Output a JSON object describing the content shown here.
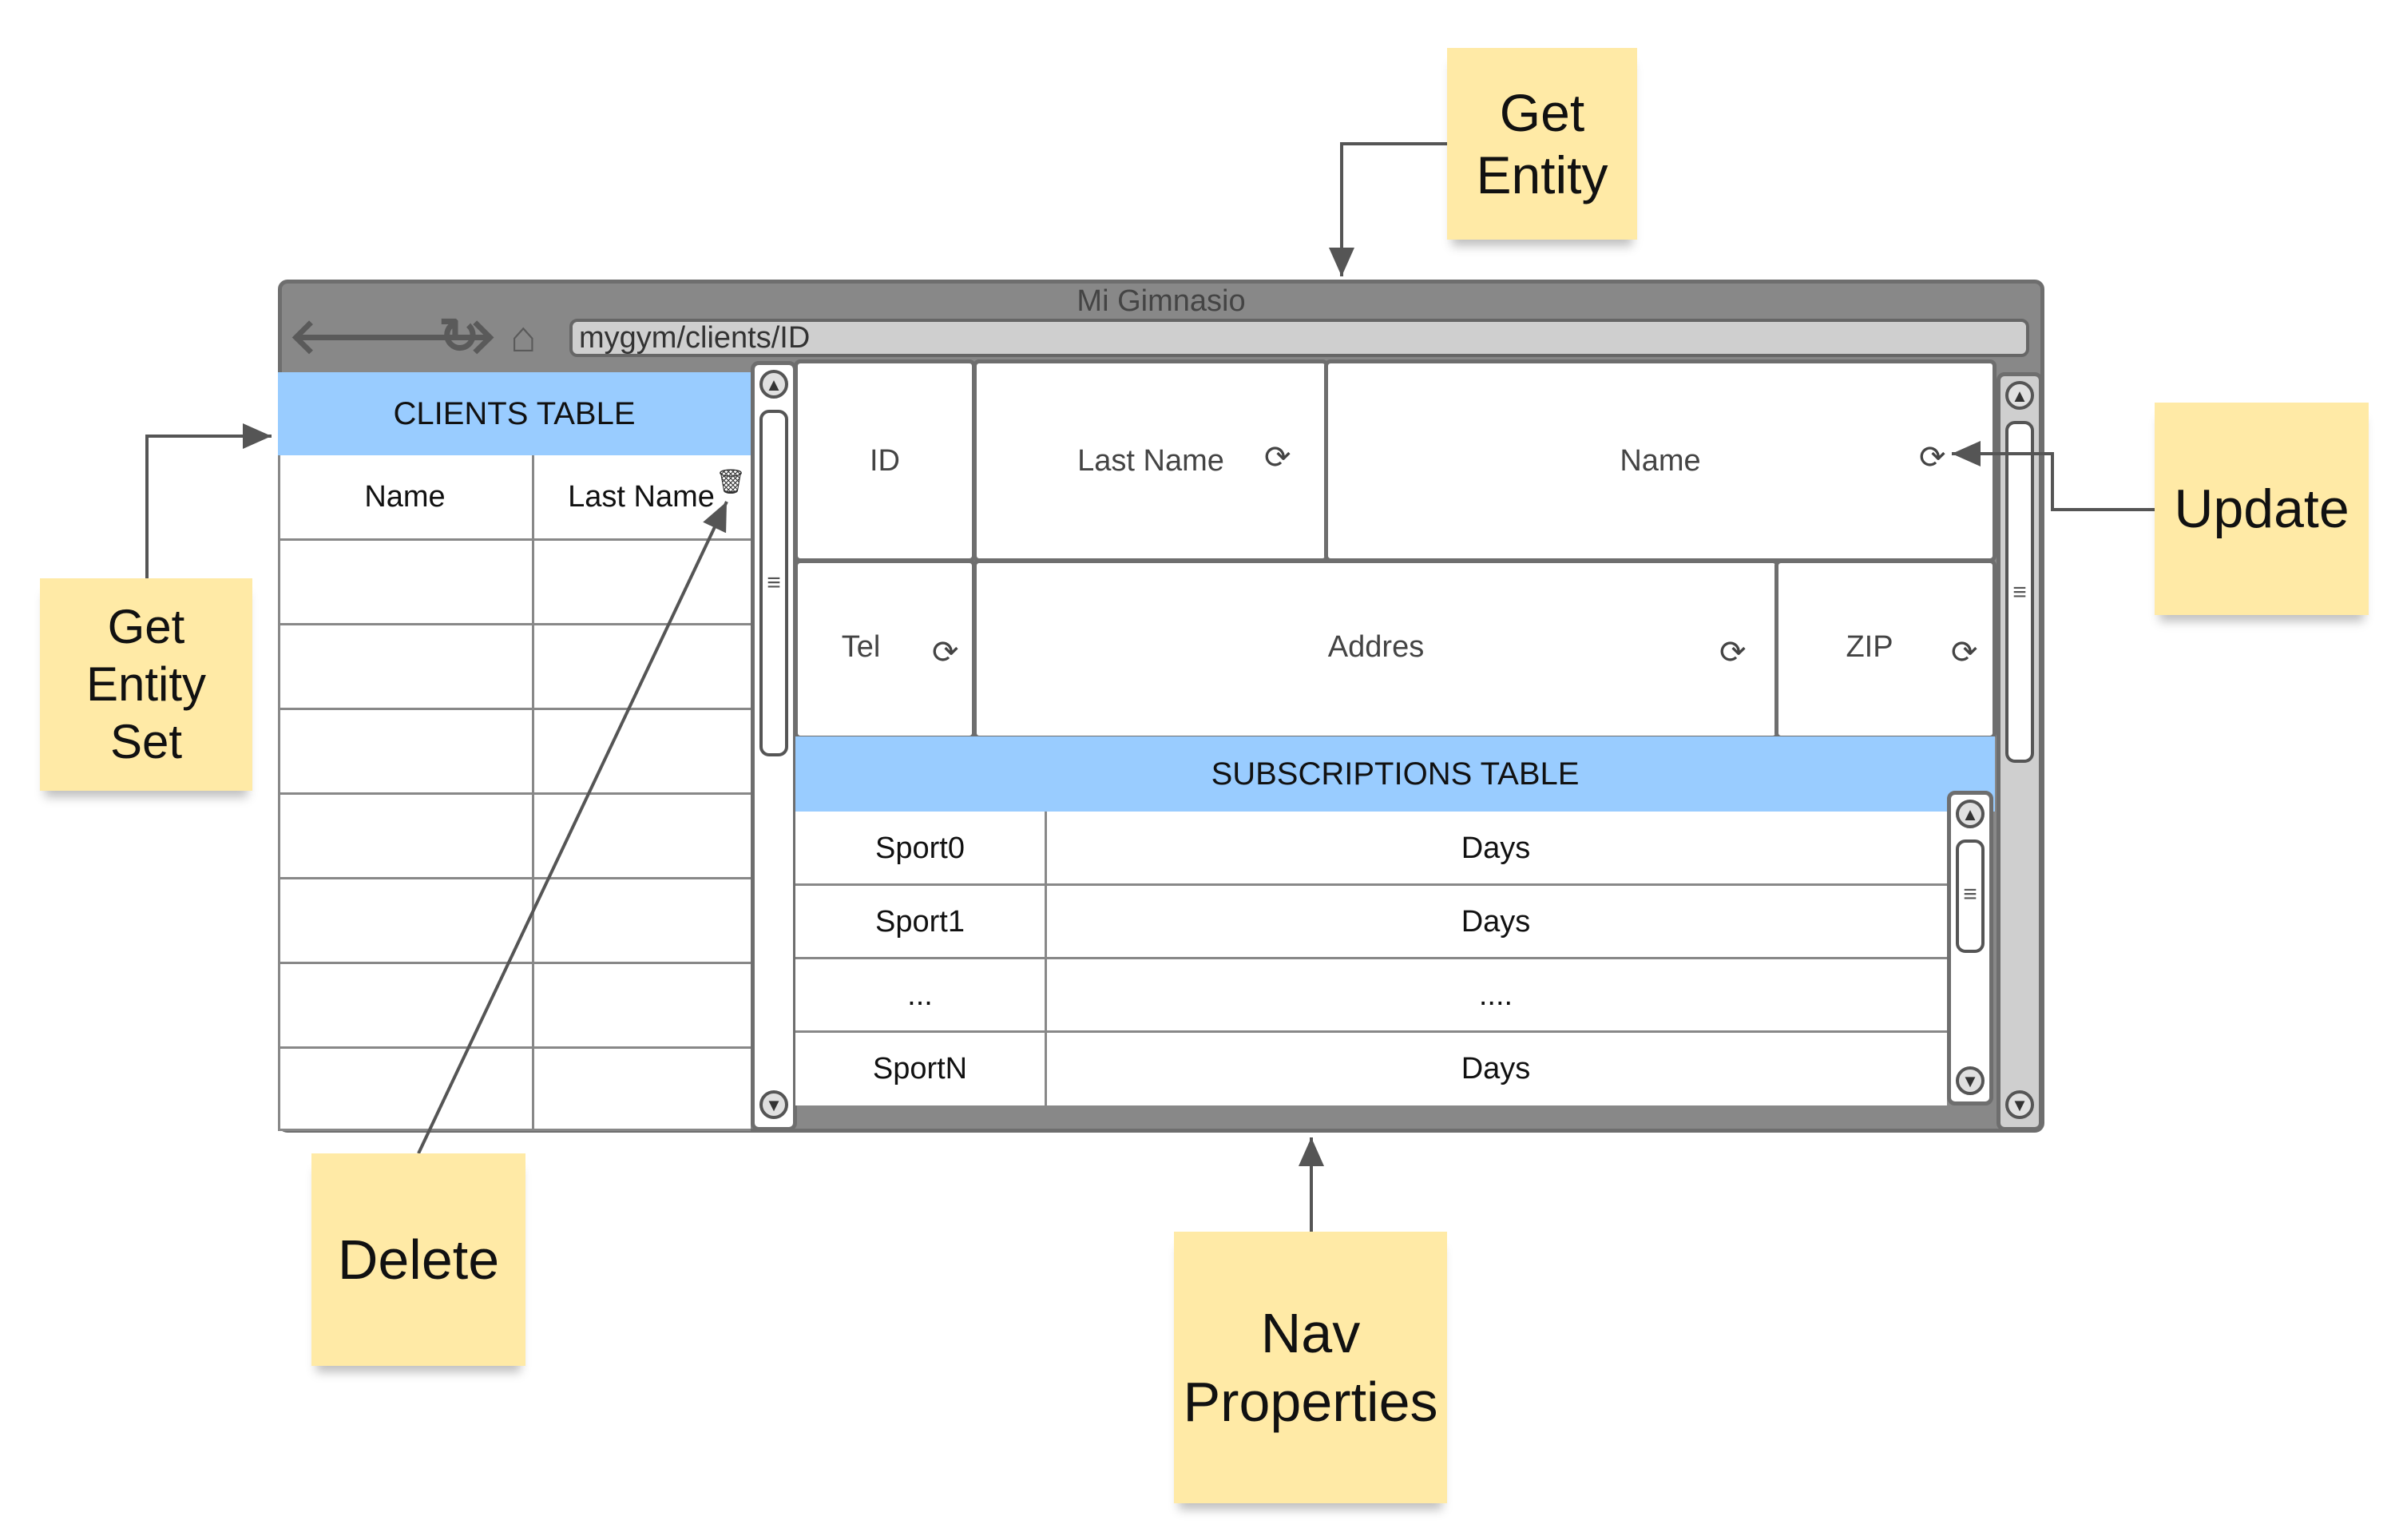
{
  "window": {
    "title": "Mi Gimnasio",
    "url": "mygym/clients/ID",
    "nav_icons": [
      "back-arrow-icon",
      "forward-arrow-icon",
      "reload-icon",
      "home-icon"
    ]
  },
  "clients_table": {
    "title": "CLIENTS TABLE",
    "columns": [
      "Name",
      "Last Name"
    ],
    "empty_rows": 7
  },
  "detail_fields": [
    {
      "label": "ID"
    },
    {
      "label": "Last Name",
      "icon": "refresh-icon"
    },
    {
      "label": "Name",
      "icon": "refresh-icon"
    },
    {
      "label": "Tel",
      "icon": "refresh-icon"
    },
    {
      "label": "Addres",
      "icon": "refresh-icon"
    },
    {
      "label": "ZIP",
      "icon": "refresh-icon"
    }
  ],
  "subscriptions_table": {
    "title": "SUBSCRIPTIONS TABLE",
    "rows": [
      [
        "Sport0",
        "Days"
      ],
      [
        "Sport1",
        "Days"
      ],
      [
        "...",
        "...."
      ],
      [
        "SportN",
        "Days"
      ]
    ]
  },
  "notes": {
    "get_entity": "Get\nEntity",
    "get_entity_set": "Get\nEntity\nSet",
    "update": "Update",
    "delete": "Delete",
    "nav_properties": "Nav\nProperties"
  },
  "colors": {
    "table_header": "#99ccff",
    "window_frame": "#888888",
    "sticky_note": "#ffeaa6"
  }
}
